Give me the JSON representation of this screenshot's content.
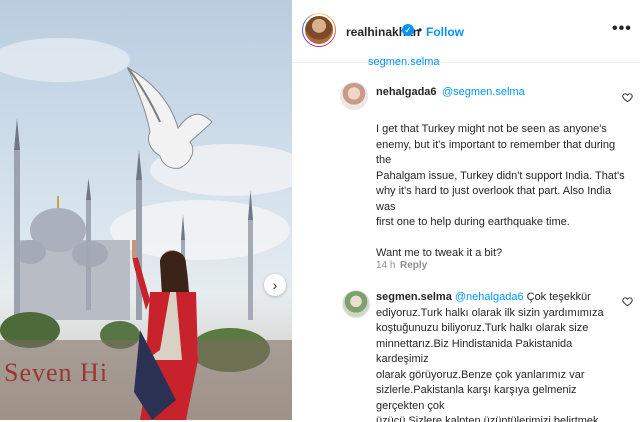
{
  "post": {
    "author": "realhinakhan",
    "follow_label": "Follow",
    "separator": "•",
    "more_label": "•••",
    "photo_watermark": "Seven Hi",
    "icons": {
      "verified": "verified-badge-icon",
      "next": "chevron-right-icon",
      "heart": "heart-icon",
      "more": "more-options-icon"
    },
    "colors": {
      "accent": "#0095f6",
      "meta": "#8e8e8e",
      "text": "#262626"
    }
  },
  "cut_off_text": "segmen.selma",
  "comments": [
    {
      "user": "nehalgada6",
      "mention": "@segmen.selma",
      "body_lines": [
        "I get that Turkey might not be seen as anyone's",
        "enemy, but it's important to remember that during the",
        "Pahalgam issue, Turkey didn't support India. That's",
        "why it's hard to just overlook that part. Also India was",
        "first one to help during earthquake time.",
        "",
        "Want me to tweak it a bit?"
      ],
      "time": "14 h",
      "reply_label": "Reply"
    },
    {
      "user": "segmen.selma",
      "mention": "@nehalgada6",
      "first_line_rest": "Çok teşekkür",
      "body_lines": [
        "ediyoruz.Turk halkı olarak ilk sizin yardımımıza",
        "koştuğunuzu biliyoruz.Turk halkı olarak size",
        "minnettarız.Biz Hindistanida Pakistanida kardeşimiz",
        "olarak görüyoruz.Benze çok yanlarımız var",
        "sizlerle.Pakistanla karşı karşıya gelmeniz gerçekten çok",
        "üzücü Sizlere kalpten üzüntülerimizi belirtmek"
      ]
    }
  ]
}
